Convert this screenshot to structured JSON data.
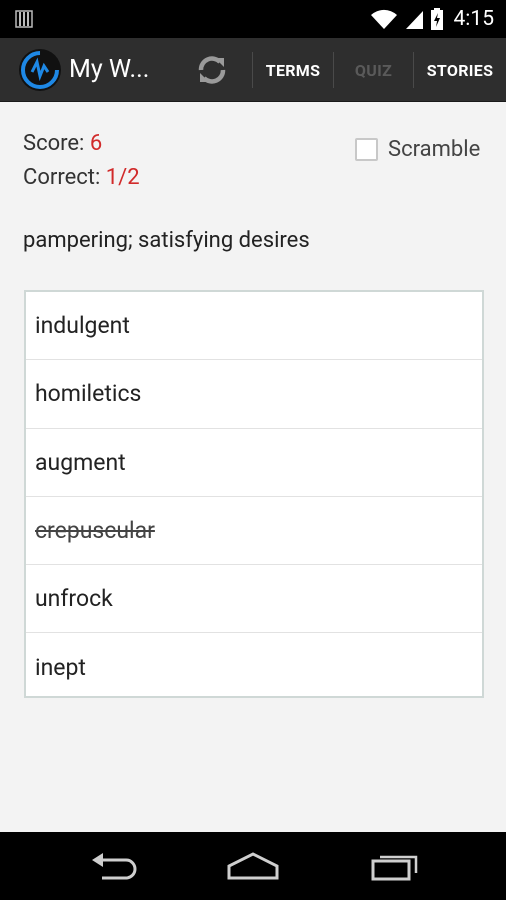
{
  "status_bar": {
    "time": "4:15",
    "icons": [
      "notification-icon",
      "wifi-icon",
      "signal-icon",
      "battery-icon"
    ]
  },
  "action_bar": {
    "app_title": "My W...",
    "app_icon": "app-logo-icon",
    "refresh_icon": "refresh-icon",
    "tabs": [
      {
        "label": "TERMS",
        "active": true
      },
      {
        "label": "QUIZ",
        "active": false
      },
      {
        "label": "STORIES",
        "active": true
      }
    ]
  },
  "quiz": {
    "score_label": "Score:",
    "score_value": "6",
    "correct_label": "Correct:",
    "correct_value": "1/2",
    "scramble_label": "Scramble",
    "scramble_checked": false,
    "definition": "pampering; satisfying desires",
    "answers": [
      {
        "text": "indulgent",
        "struck": false
      },
      {
        "text": "homiletics",
        "struck": false
      },
      {
        "text": "augment",
        "struck": false
      },
      {
        "text": "crepuscular",
        "struck": true
      },
      {
        "text": "unfrock",
        "struck": false
      },
      {
        "text": "inept",
        "struck": false
      }
    ]
  },
  "colors": {
    "accent_red": "#d12a2a",
    "action_bar": "#2e2e2e",
    "app_icon_blue": "#1e88e5"
  },
  "nav_bar": {
    "icons": [
      "back-icon",
      "home-icon",
      "recents-icon"
    ]
  }
}
